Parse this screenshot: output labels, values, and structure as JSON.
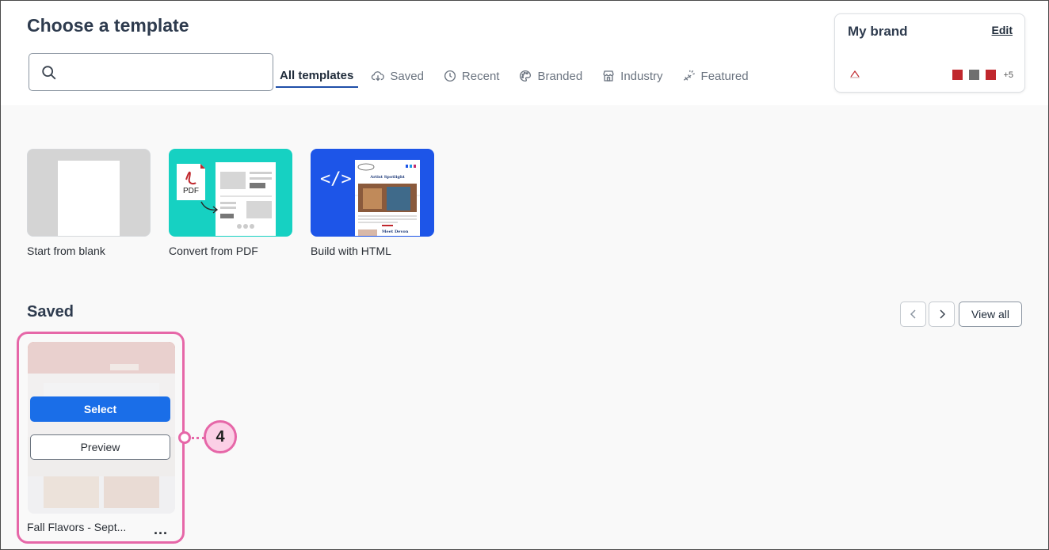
{
  "header": {
    "title": "Choose a template",
    "search": {
      "value": "",
      "placeholder": ""
    },
    "tabs": [
      {
        "label": "All templates",
        "icon": "none",
        "active": true
      },
      {
        "label": "Saved",
        "icon": "cloud-download-icon"
      },
      {
        "label": "Recent",
        "icon": "clock-icon"
      },
      {
        "label": "Branded",
        "icon": "palette-icon"
      },
      {
        "label": "Industry",
        "icon": "storefront-icon"
      },
      {
        "label": "Featured",
        "icon": "megaphone-icon"
      }
    ]
  },
  "brand": {
    "title": "My brand",
    "edit_label": "Edit",
    "swatches": [
      "#c0272d",
      "#6f6f6f",
      "#c0272d"
    ],
    "more_label": "+5"
  },
  "start_tiles": [
    {
      "label": "Start from blank"
    },
    {
      "label": "Convert from PDF",
      "pdf_badge": "PDF"
    },
    {
      "label": "Build with HTML",
      "code_glyph": "</>",
      "preview_heading": "Artist Spotlight",
      "preview_subheading": "Meet Devon"
    }
  ],
  "saved": {
    "title": "Saved",
    "view_all_label": "View all",
    "cards": [
      {
        "name": "Fall Flavors - Sept...",
        "select_label": "Select",
        "preview_label": "Preview",
        "more_label": "..."
      }
    ]
  },
  "callout": {
    "number": "4"
  },
  "colors": {
    "accent": "#1a6ee8",
    "active_tab_underline": "#1f4fa8",
    "callout_pink": "#e667a8",
    "pdf_tile": "#16d1c2",
    "html_tile": "#1d55e8"
  }
}
